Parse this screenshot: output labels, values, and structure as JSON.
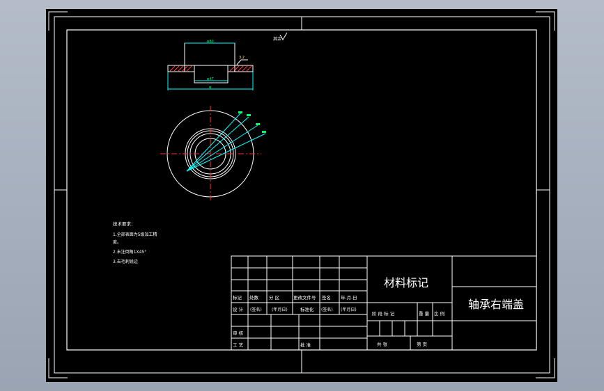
{
  "drawing": {
    "title_block": {
      "material_mark": "材料标记",
      "part_name": "轴承右端盖",
      "row_labels": {
        "mark": "标记",
        "count": "处数",
        "zone": "分 区",
        "change_doc_no": "更改文件号",
        "signature": "签名",
        "date": "年.月.日",
        "design": "设  计",
        "sign_paren": "(签名)",
        "date_paren": "(年月日)",
        "standardize": "标准化",
        "review": "审  核",
        "process": "工  艺",
        "approve": "批  准",
        "stage_mark": "阶 段 标 记",
        "weight": "重 量",
        "scale": "比 例",
        "sheets_total": "共   张",
        "sheet_no": "第   页"
      }
    },
    "tech_requirements": {
      "heading": "技术要求：",
      "lines": [
        "1.全部表面为5级加工精",
        "  度。",
        "2.未注倒角1X45°",
        "3.去毛刺锐边"
      ]
    },
    "annotations": {
      "roughness_label": "其余",
      "section_dim_top": "φ80",
      "section_dim_bottom": "φ47",
      "section_dim_base": "φ",
      "surface_mark": "3.2"
    },
    "colors": {
      "background": "#000000",
      "lines": "#ffffff",
      "dimension": "#00ffff",
      "center_line": "#ff3030",
      "hatch": "#ff4040",
      "fill_yellow": "#ffff66"
    }
  }
}
